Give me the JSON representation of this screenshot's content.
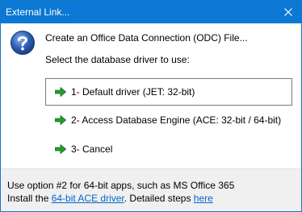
{
  "window": {
    "title": "External Link...",
    "accent_color": "#0a78d4"
  },
  "dialog": {
    "icon": "question-mark-icon",
    "heading": "Create an Office Data Connection (ODC) File...",
    "instruction": "Select the database driver to use:",
    "options": [
      {
        "label": "1- Default driver (JET: 32-bit)",
        "is_default": true,
        "icon": "green-arrow-icon"
      },
      {
        "label": "2- Access Database Engine (ACE: 32-bit / 64-bit)",
        "is_default": false,
        "icon": "green-arrow-icon"
      },
      {
        "label": "3- Cancel",
        "is_default": false,
        "icon": "green-arrow-icon"
      }
    ]
  },
  "footer": {
    "line1": "Use option #2 for 64-bit apps, such as MS Office 365",
    "line2_prefix": "Install the ",
    "ace_link": "64-bit ACE driver",
    "line2_middle": ". Detailed steps ",
    "here_link": "here"
  }
}
